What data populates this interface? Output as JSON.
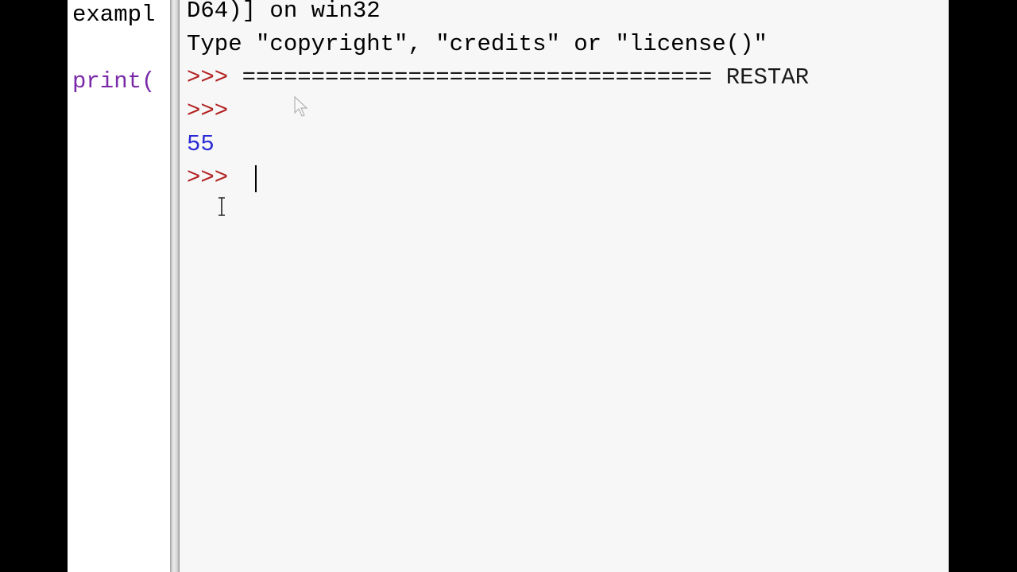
{
  "editor": {
    "lines": [
      "exampl",
      "print("
    ]
  },
  "shell": {
    "lines": {
      "header_tail": "D64)] on win32",
      "type_hint": "Type \"copyright\", \"credits\" or \"license()\"",
      "restart_prompt": ">>>",
      "restart_text": "================================== RESTAR",
      "prompt2": ">>>",
      "output": "55",
      "prompt3": ">>>"
    },
    "colors": {
      "prompt": "#b22222",
      "output": "#2b2bd6",
      "editor_keyword": "#7a2aa8",
      "background": "#f7f7f7"
    }
  },
  "icons": [
    "arrow-pointer-icon",
    "ibeam-cursor-icon"
  ]
}
